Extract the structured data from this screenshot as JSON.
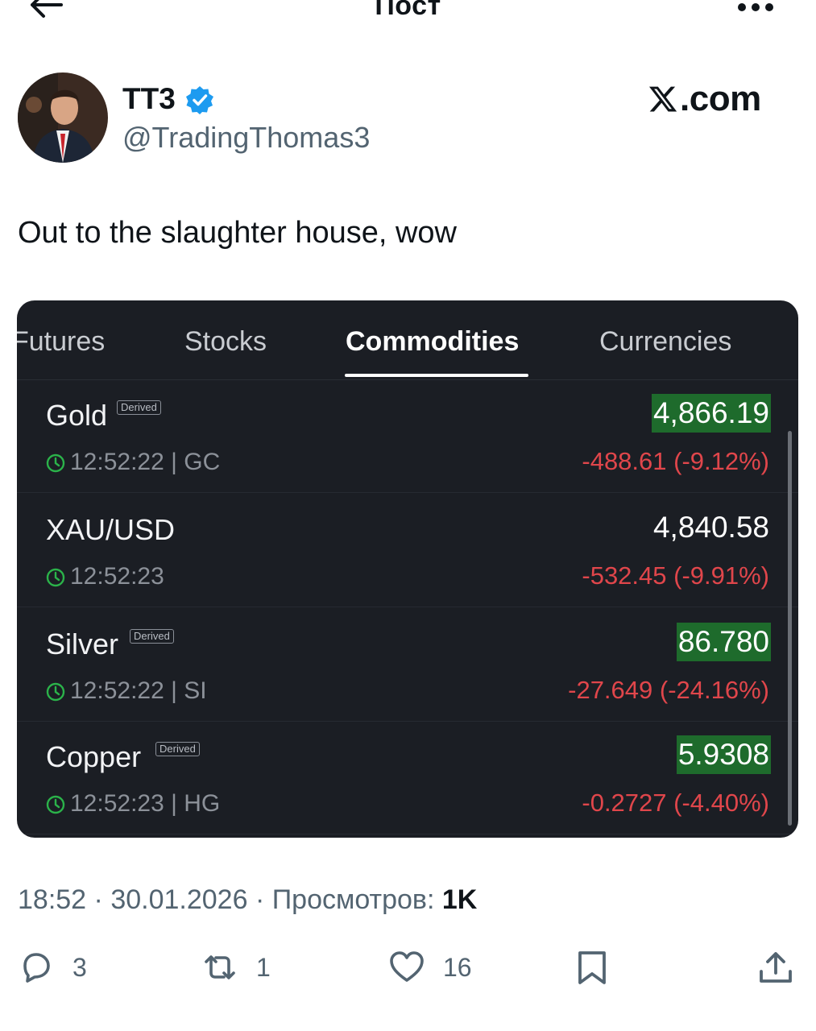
{
  "header": {
    "title": "Пост"
  },
  "author": {
    "name": "TT3",
    "handle": "@TradingThomas3",
    "site": ".com"
  },
  "tweet": {
    "text": "Out to the slaughter house, wow"
  },
  "card": {
    "tabs": [
      "Futures",
      "Stocks",
      "Commodities",
      "Currencies"
    ],
    "active_tab": "Commodities",
    "badge_label": "Derived",
    "rows": [
      {
        "name": "Gold",
        "derived": true,
        "meta": "12:52:22 | GC",
        "price": "4,866.19",
        "highlight": true,
        "change": "-488.61 (-9.12%)"
      },
      {
        "name": "XAU/USD",
        "derived": false,
        "meta": "12:52:23",
        "price": "4,840.58",
        "highlight": false,
        "change": "-532.45 (-9.91%)"
      },
      {
        "name": "Silver",
        "derived": true,
        "meta": "12:52:22 | SI",
        "price": "86.780",
        "highlight": true,
        "change": "-27.649 (-24.16%)"
      },
      {
        "name": "Copper",
        "derived": true,
        "meta": "12:52:23 | HG",
        "price": "5.9308",
        "highlight": true,
        "change": "-0.2727 (-4.40%)"
      }
    ],
    "colors": {
      "up_highlight": "#1e6b2c",
      "negative": "#e0464b",
      "background": "#1b1e24"
    }
  },
  "meta": {
    "time": "18:52",
    "date": "30.01.2026",
    "views_label": "Просмотров:",
    "views": "1K"
  },
  "actions": {
    "replies": "3",
    "reposts": "1",
    "likes": "16"
  },
  "icons": [
    "back-arrow-icon",
    "more-icon",
    "verified-icon",
    "x-logo-icon",
    "clock-icon",
    "reply-icon",
    "repost-icon",
    "like-icon",
    "bookmark-icon",
    "share-icon"
  ]
}
